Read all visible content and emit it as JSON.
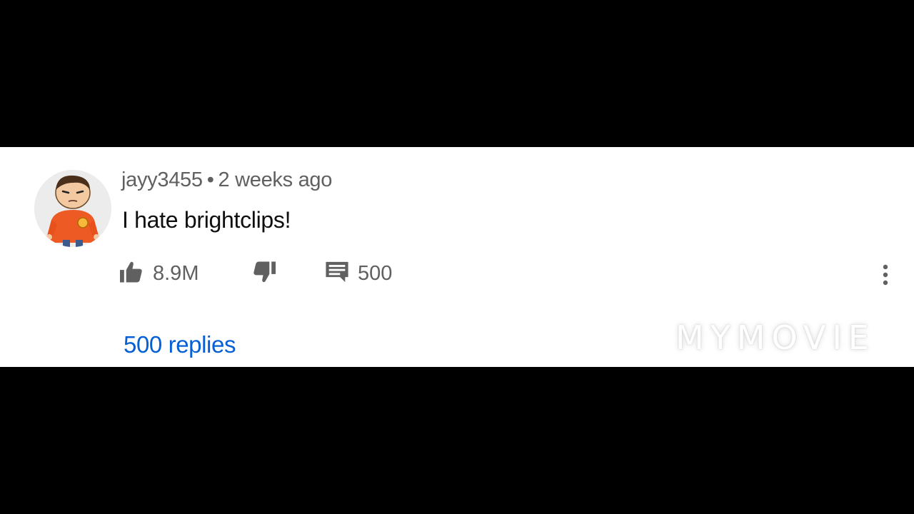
{
  "comment": {
    "author": "jayy3455",
    "separator": "•",
    "timestamp": "2 weeks ago",
    "text": "I hate brightclips!",
    "like_count": "8.9M",
    "reply_count_short": "500",
    "replies_link": "500 replies"
  },
  "icons": {
    "like": "thumbs-up-icon",
    "dislike": "thumbs-down-icon",
    "reply": "comment-icon",
    "more": "more-vertical-icon",
    "avatar": "cartoon-avatar"
  },
  "colors": {
    "link": "#065fd4",
    "meta_text": "#606060",
    "body_text": "#0f0f0f",
    "panel_bg": "#ffffff",
    "letterbox": "#000000"
  },
  "watermark": "MYMOVIE"
}
